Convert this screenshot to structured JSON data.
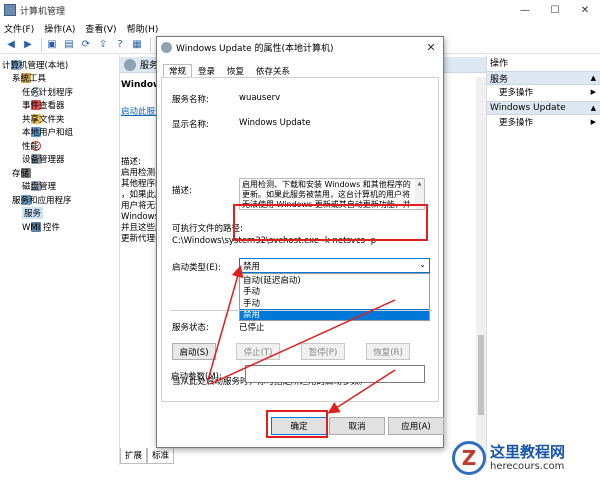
{
  "window": {
    "title": "计算机管理",
    "controls": [
      "—",
      "☐",
      "✕"
    ]
  },
  "menu": [
    "文件(F)",
    "操作(A)",
    "查看(V)",
    "帮助(H)"
  ],
  "tree": [
    {
      "label": "计算机管理(本地)",
      "icon": "computer-icon",
      "exp": "",
      "indent": 0
    },
    {
      "label": "系统工具",
      "icon": "tools-icon",
      "exp": "⌄",
      "indent": 1
    },
    {
      "label": "任务计划程序",
      "icon": "clock-icon",
      "exp": "›",
      "indent": 2
    },
    {
      "label": "事件查看器",
      "icon": "log-icon",
      "exp": "›",
      "indent": 2
    },
    {
      "label": "共享文件夹",
      "icon": "folder-icon",
      "exp": "›",
      "indent": 2
    },
    {
      "label": "本地用户和组",
      "icon": "users-icon",
      "exp": "›",
      "indent": 2
    },
    {
      "label": "性能",
      "icon": "perf-icon",
      "exp": "›",
      "indent": 2
    },
    {
      "label": "设备管理器",
      "icon": "device-icon",
      "exp": "",
      "indent": 2
    },
    {
      "label": "存储",
      "icon": "storage-icon",
      "exp": "⌄",
      "indent": 1
    },
    {
      "label": "磁盘管理",
      "icon": "disk-icon",
      "exp": "",
      "indent": 2
    },
    {
      "label": "服务和应用程序",
      "icon": "apps-icon",
      "exp": "⌄",
      "indent": 1
    },
    {
      "label": "服务",
      "icon": "gear-icon",
      "exp": "",
      "indent": 2,
      "selected": true
    },
    {
      "label": "WMI 控件",
      "icon": "wmi-icon",
      "exp": "",
      "indent": 2
    }
  ],
  "center": {
    "header": "服务",
    "heading": "Windows",
    "start_link": "启动此服务",
    "desc_lines": [
      "描述:",
      "启用检测、",
      "其他程序的",
      "，如果此服",
      "用户将无法",
      "Windows",
      "并且这些服",
      "更新代理(W"
    ],
    "right_col": [
      "",
      "",
      "",
      "",
      "",
      "",
      "",
      "",
      "",
      "",
      "",
      "",
      "",
      "",
      "",
      "",
      "",
      ""
    ]
  },
  "bottom_tabs": [
    "扩展",
    "标准"
  ],
  "actions": {
    "title": "操作",
    "sections": [
      {
        "name": "服务",
        "link": "更多操作"
      },
      {
        "name": "Windows Update",
        "link": "更多操作"
      }
    ]
  },
  "dialog": {
    "title": "Windows Update 的属性(本地计算机)",
    "tabs": [
      "常规",
      "登录",
      "恢复",
      "依存关系"
    ],
    "service_name_label": "服务名称:",
    "service_name": "wuauserv",
    "display_name_label": "显示名称:",
    "display_name": "Windows Update",
    "description_label": "描述:",
    "description": "启用检测、下载和安装 Windows 和其他程序的更新。如果此服务被禁用，这台计算机的用户将无法使用 Windows 更新或其自动更新功能，并且这些程序",
    "exe_path_label": "可执行文件的路径:",
    "exe_path": "C:\\Windows\\system32\\svchost.exe -k netsvcs -p",
    "startup_type_label": "启动类型(E):",
    "startup_type": "禁用",
    "startup_options": [
      "自动(延迟启动)",
      "手动",
      "手动",
      "禁用"
    ],
    "status_label": "服务状态:",
    "status": "已停止",
    "buttons": {
      "start": "启动(S)",
      "stop": "停止(T)",
      "pause": "暂停(P)",
      "resume": "恢复(R)"
    },
    "hint": "当从此处启动服务时，你可指定所适用的启动参数。",
    "params_label": "启动参数(M):",
    "ok": "确定",
    "cancel": "取消",
    "apply": "应用(A)"
  },
  "watermark": {
    "cn": "这里教程网",
    "en": "herecours.com",
    "logo_letter": "Z"
  },
  "colors": {
    "annotation_red": "#e02020",
    "selection_blue": "#0078d7",
    "header_blue": "#dde8f3"
  }
}
